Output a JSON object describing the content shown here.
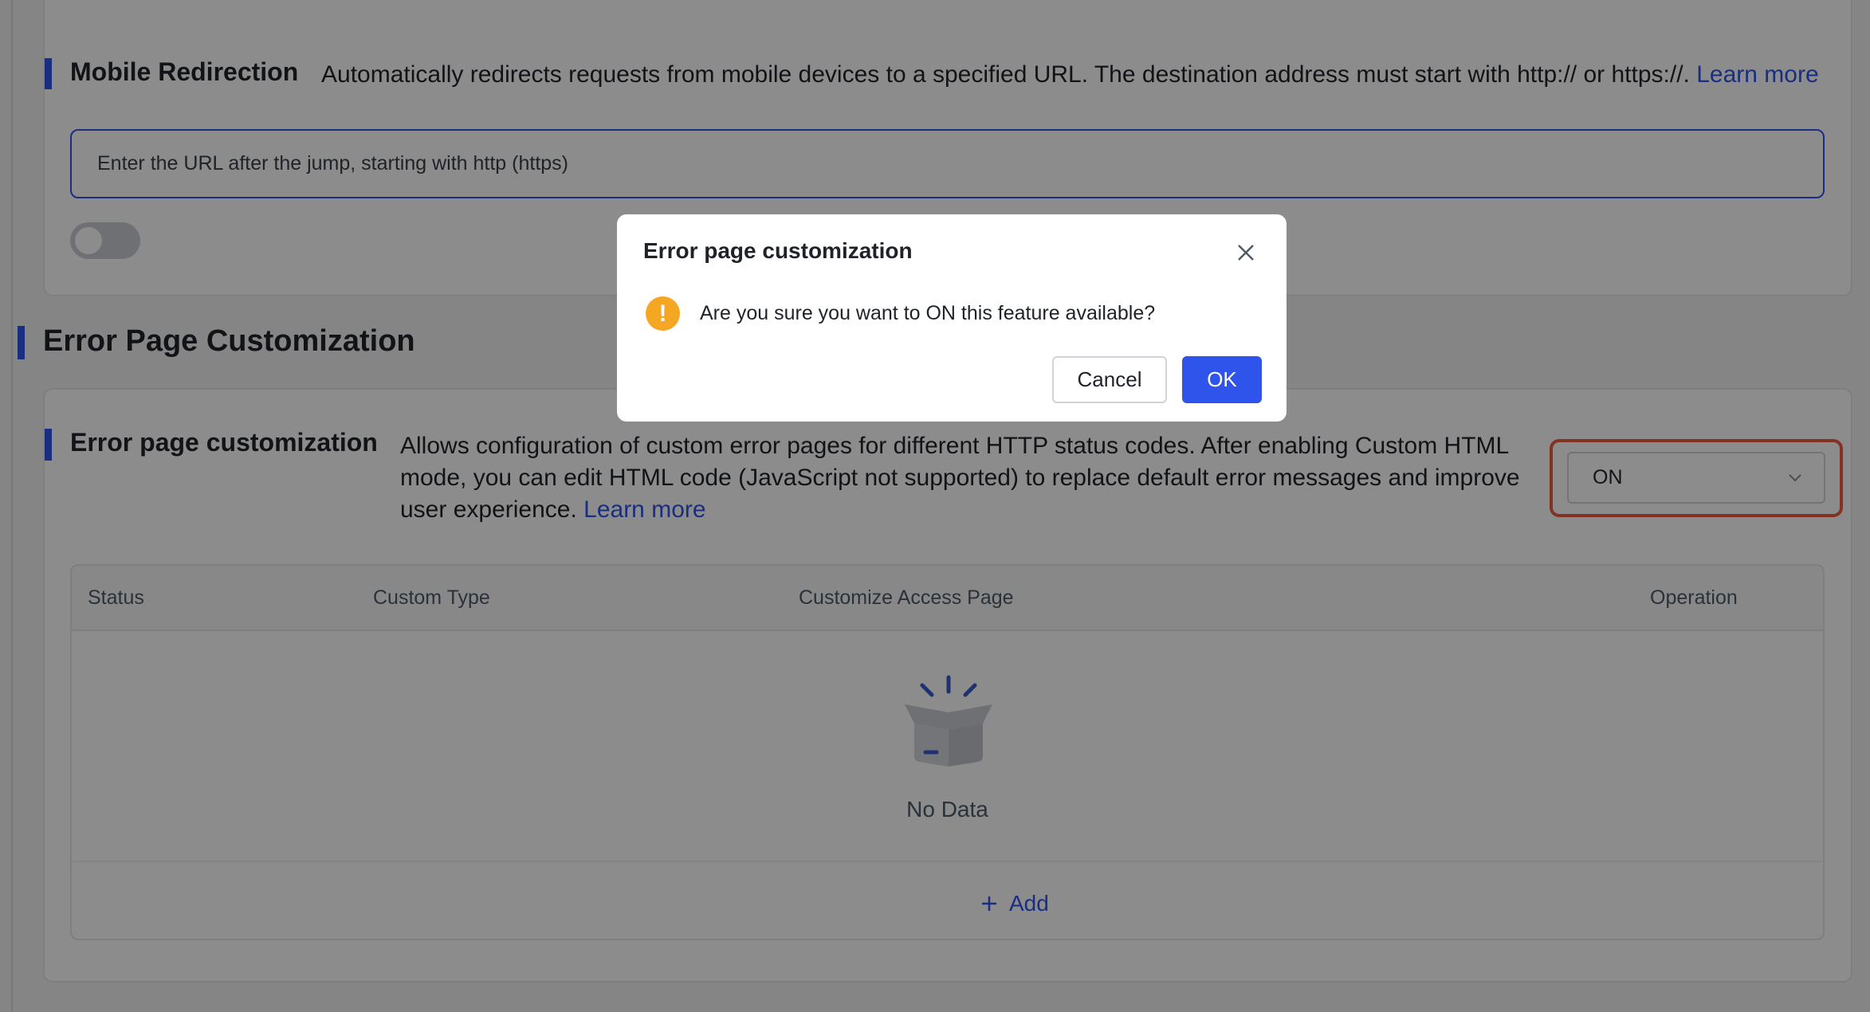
{
  "mobile_redirection": {
    "title": "Mobile Redirection",
    "description": "Automatically redirects requests from mobile devices to a specified URL. The destination address must start with http:// or https://.",
    "learn_more": "Learn more",
    "url_placeholder": "Enter the URL after the jump, starting with http (https)",
    "toggle_on": false
  },
  "section": {
    "title": "Error Page Customization"
  },
  "error_page": {
    "title": "Error page customization",
    "description": "Allows configuration of custom error pages for different HTTP status codes. After enabling Custom HTML mode, you can edit HTML code (JavaScript not supported) to replace default error messages and improve user experience.",
    "learn_more": "Learn more",
    "select_value": "ON",
    "table": {
      "columns": [
        "Status",
        "Custom Type",
        "Customize Access Page",
        "Operation"
      ],
      "rows": [],
      "empty_text": "No Data",
      "add_label": "Add"
    }
  },
  "modal": {
    "title": "Error page customization",
    "message": "Are you sure you want to ON this feature available?",
    "cancel_label": "Cancel",
    "ok_label": "OK"
  },
  "colors": {
    "accent": "#2f54eb",
    "warning": "#f5a623",
    "highlight": "#f25c41"
  },
  "icons": {
    "close": "close-icon",
    "warning": "exclamation-icon",
    "chevron": "chevron-down-icon",
    "empty": "empty-box-icon",
    "add": "plus-icon"
  }
}
